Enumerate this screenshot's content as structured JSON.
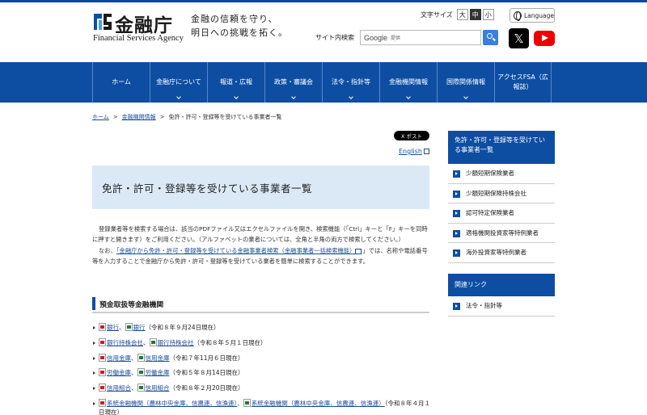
{
  "header": {
    "logo_jp": "金融庁",
    "logo_en": "Financial Services Agency",
    "tagline_1": "金融の信頼を守り、",
    "tagline_2": "明日への挑戦を拓く。",
    "font_size_label": "文字サイズ",
    "font_large": "大",
    "font_medium": "中",
    "font_small": "小",
    "language": "Language",
    "search_label": "サイト内検索",
    "search_brand": "Google",
    "search_placeholder": "提供",
    "x_label": "𝕏"
  },
  "nav": {
    "items": [
      "ホーム",
      "金融庁について",
      "報道・広報",
      "政策・審議会",
      "法令・指針等",
      "金融機関情報",
      "国際関係情報",
      "アクセスFSA（広報誌）"
    ]
  },
  "breadcrumb": {
    "home": "ホーム",
    "sep": ">",
    "level2": "金融機関情報",
    "current": "免許・許可・登録等を受けている事業者一覧"
  },
  "main": {
    "post_button": "X ポスト",
    "english_link": "English",
    "title": "免許・許可・登録等を受けている事業者一覧",
    "intro_1": "登録業者等を検索する場合は、該当のPDFファイル又はエクセルファイルを開き、検索機能（「Ctrl」キーと「F」キーを同時に押すと開きます）をご利用ください。（アルファベットの業者については、全角と半角の両方で検索してください。）",
    "intro_2_pre": "なお、",
    "intro_2_link": "「金融庁から免許・許可・登録等を受けている金融事業者検索（金融事業者一括検索機能）",
    "intro_2_post": "」では、名称や電話番号等を入力することで金融庁から免許・許可・登録等を受けている業者を簡単に検索することができます。",
    "section_title": "預金取扱等金融機関",
    "banks": [
      {
        "name": "銀行",
        "date": "（令和８年９月24日現在）"
      },
      {
        "name": "銀行持株会社",
        "date": "（令和８年５月１日現在）"
      },
      {
        "name": "信用金庫",
        "date": "（令和７年11月６日現在）"
      },
      {
        "name": "労働金庫",
        "date": "（令和５年８月14日現在）"
      },
      {
        "name": "信用組合",
        "date": "（令和８年２月20日現在）"
      },
      {
        "name": "系統金融機関（農林中央金庫、信農連、信漁連）",
        "date": "（令和８年４月１日現在）"
      }
    ],
    "sep": "、"
  },
  "sidebar": {
    "head1": "免許・許可・登録等を受けている事業者一覧",
    "items1": [
      "少額短期保険業者",
      "少額短期保険持株会社",
      "認可特定保険業者",
      "適格機関投資家等特例業者",
      "海外投資家等特例業者"
    ],
    "head2": "関連リンク",
    "items2": [
      "法令・指針等"
    ]
  }
}
